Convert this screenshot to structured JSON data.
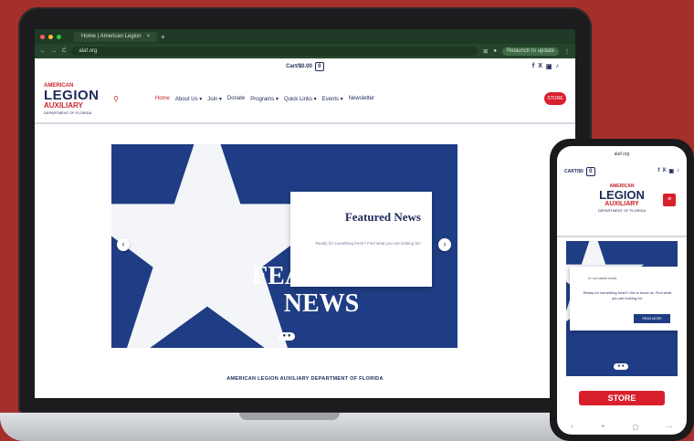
{
  "headline": {
    "fragment": "..."
  },
  "browser": {
    "tab_title": "Home | American Legion",
    "tab_close": "×",
    "url": "alaf.org",
    "relaunch": "Relaunch to update",
    "nav_back": "←",
    "nav_forward": "→",
    "reload": "C"
  },
  "site": {
    "cart_label": "Cart/$0.00",
    "cart_count": "0",
    "socials": [
      "f",
      "X",
      "▣",
      "♪"
    ],
    "logo": {
      "line1": "AMERICAN",
      "line2": "LEGION",
      "line3": "AUXILIARY",
      "line4": "DEPARTMENT OF FLORIDA"
    },
    "search_icon": "⚲",
    "nav": [
      {
        "label": "Home",
        "active": true
      },
      {
        "label": "About Us ▾"
      },
      {
        "label": "Join ▾"
      },
      {
        "label": "Donate"
      },
      {
        "label": "Programs ▾"
      },
      {
        "label": "Quick Links ▾"
      },
      {
        "label": "Events ▾"
      },
      {
        "label": "Newsletter"
      }
    ],
    "store_button": "STORE",
    "hero": {
      "overlay_text": "FEATURED NEWS",
      "card_title": "Featured News",
      "card_text": "Ready for something fresh? Find what you are looking for!",
      "prev": "‹",
      "next": "›",
      "dots": "● ●"
    },
    "footer_band": "AMERICAN LEGION AUXILIARY DEPARTMENT OF FLORIDA"
  },
  "phone": {
    "url": "alaf.org",
    "cart_label": "CART/$0",
    "cart_count": "0",
    "socials": [
      "f",
      "X",
      "▣",
      "♪"
    ],
    "logo": {
      "line1": "AMERICAN",
      "line2": "LEGION",
      "line3": "AUXILIARY",
      "line4": "DEPARTMENT OF FLORIDA"
    },
    "menu_icon": "≡",
    "card_small": "In our latest news",
    "card_text": "Ready for something fresh? Get to know us. Find what you are looking for.",
    "card_button": "READ MORE",
    "dots": "● ●",
    "store_button": "STORE",
    "bottom_nav": [
      "‹",
      "+",
      "▢",
      "⋯"
    ]
  },
  "colors": {
    "background": "#a52f2b",
    "navy": "#1e2a5a",
    "red": "#d8202d",
    "hero_blue": "#1f3d84"
  }
}
